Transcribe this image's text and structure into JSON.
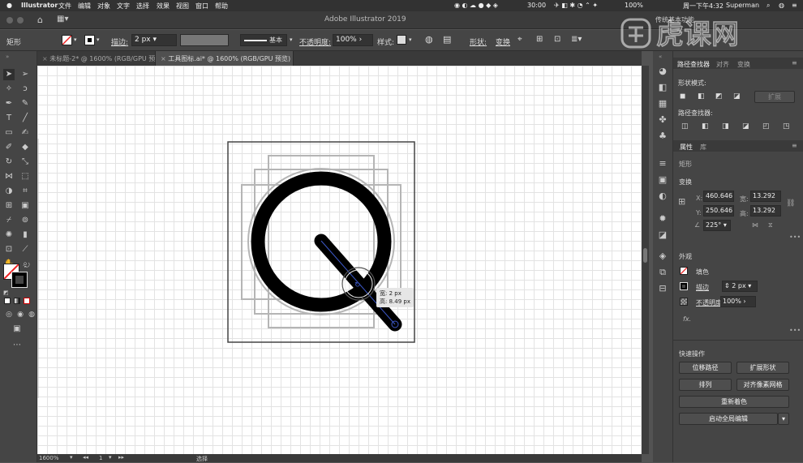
{
  "menubar": {
    "app": "Illustrator",
    "items": [
      "文件",
      "编辑",
      "对象",
      "文字",
      "选择",
      "效果",
      "视图",
      "窗口",
      "帮助"
    ],
    "clock": "周一下午4:32",
    "battery": "100%",
    "time_elapsed": "30:00",
    "user": "Superman"
  },
  "titlebar": {
    "title": "Adobe Illustrator 2019",
    "workspace": "传统基本功能"
  },
  "controlbar": {
    "shape_label": "矩形",
    "stroke_label": "描边:",
    "stroke_value": "2 px",
    "profile_label": "基本",
    "opacity_label": "不透明度:",
    "opacity_value": "100%",
    "style_label": "样式:",
    "shape_link": "形状:",
    "transform_link": "变换"
  },
  "tabs": [
    {
      "label": "未标题-2* @ 1600% (RGB/GPU 预览)"
    },
    {
      "label": "工具图标.ai* @ 1600% (RGB/GPU 预览)"
    }
  ],
  "tooltip": {
    "w": "宽: 2 px",
    "h": "高: 8.49 px"
  },
  "statusbar": {
    "zoom": "1600%",
    "page": "1",
    "tool": "选择"
  },
  "watermark": "虎课网",
  "rightpanel": {
    "tabs": [
      "路径查找器",
      "对齐",
      "变换"
    ],
    "shape_modes": "形状模式:",
    "expand": "扩展",
    "pathfinders": "路径查找器:",
    "props_tabs": [
      "属性",
      "库"
    ],
    "object_type": "矩形",
    "transform": "变换",
    "x_label": "X:",
    "x_value": "460.646",
    "w_label": "宽:",
    "w_value": "13.292 p",
    "y_label": "Y:",
    "y_value": "250.646",
    "h_label": "高:",
    "h_value": "13.292 p",
    "angle": "225°",
    "appearance": "外观",
    "fill": "填色",
    "stroke": "描边",
    "stroke_value": "2 px",
    "opacity": "不透明度",
    "opacity_value": "100%",
    "fx": "fx.",
    "quick_actions": "快速操作",
    "btn_offset": "位移路径",
    "btn_expand_shape": "扩展形状",
    "btn_arrange": "排列",
    "btn_align_pixel": "对齐像素网格",
    "btn_recolor": "重新着色",
    "btn_global_edit": "启动全局编辑"
  }
}
